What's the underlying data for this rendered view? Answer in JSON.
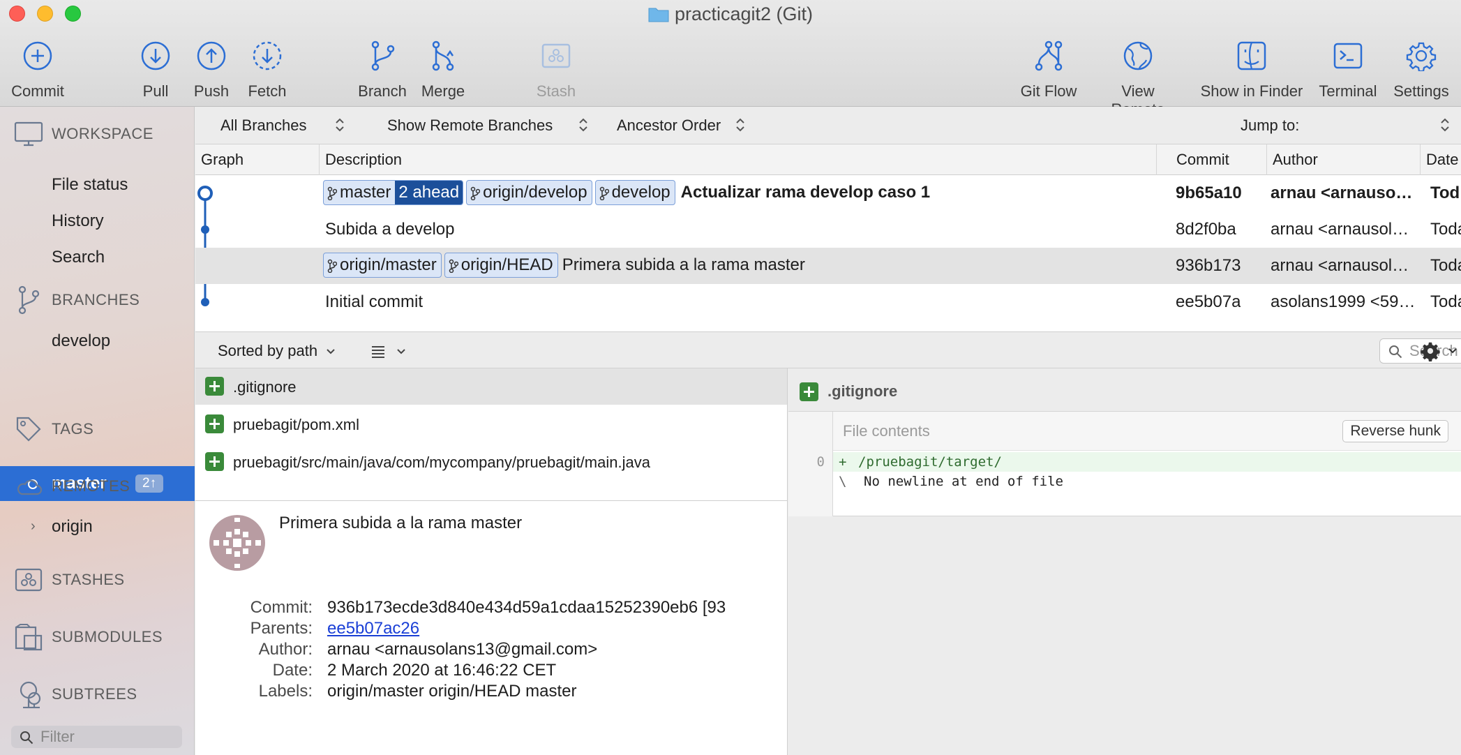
{
  "window": {
    "title": "practicagit2 (Git)"
  },
  "toolbar": {
    "commit": "Commit",
    "pull": "Pull",
    "push": "Push",
    "fetch": "Fetch",
    "branch": "Branch",
    "merge": "Merge",
    "stash": "Stash",
    "git_flow": "Git Flow",
    "view_remote": "View Remote",
    "show_in_finder": "Show in Finder",
    "terminal": "Terminal",
    "settings": "Settings"
  },
  "sidebar": {
    "workspace": "WORKSPACE",
    "workspace_items": [
      "File status",
      "History",
      "Search"
    ],
    "branches": "BRANCHES",
    "branch_items": [
      "develop",
      "master"
    ],
    "master_badge": "2↑",
    "tags": "TAGS",
    "remotes": "REMOTES",
    "remote_items": [
      "origin"
    ],
    "stashes": "STASHES",
    "submodules": "SUBMODULES",
    "subtrees": "SUBTREES",
    "filter_placeholder": "Filter"
  },
  "filters": {
    "branches": "All Branches",
    "remote": "Show Remote Branches",
    "order": "Ancestor Order",
    "jump": "Jump to:"
  },
  "columns": {
    "graph": "Graph",
    "description": "Description",
    "commit": "Commit",
    "author": "Author",
    "date": "Date"
  },
  "commits": [
    {
      "description": "Actualizar rama develop caso 1",
      "hash": "9b65a10",
      "author": "arnau <arnauso…",
      "date": "Tod",
      "bold": true,
      "labels": [
        {
          "name": "master",
          "ahead": "2 ahead"
        },
        {
          "name": "origin/develop"
        },
        {
          "name": "develop"
        }
      ]
    },
    {
      "description": "Subida a develop",
      "hash": "8d2f0ba",
      "author": "arnau <arnausol…",
      "date": "Toda",
      "labels": []
    },
    {
      "description": "Primera subida a la rama master",
      "hash": "936b173",
      "author": "arnau <arnausol…",
      "date": "Toda",
      "selected": true,
      "labels": [
        {
          "name": "origin/master"
        },
        {
          "name": "origin/HEAD"
        }
      ]
    },
    {
      "description": "Initial commit",
      "hash": "ee5b07a",
      "author": "asolans1999 <59…",
      "date": "Toda",
      "labels": []
    }
  ],
  "files_toolbar": {
    "sort": "Sorted by path",
    "search_placeholder": "Search"
  },
  "files": [
    ".gitignore",
    "pruebagit/pom.xml",
    "pruebagit/src/main/java/com/mycompany/pruebagit/main.java"
  ],
  "detail": {
    "message": "Primera subida a la rama master",
    "commit_label": "Commit:",
    "commit": "936b173ecde3d840e434d59a1cdaa15252390eb6 [93",
    "parents_label": "Parents:",
    "parents": "ee5b07ac26",
    "author_label": "Author:",
    "author": "arnau <arnausolans13@gmail.com>",
    "date_label": "Date:",
    "date": "2 March 2020 at 16:46:22 CET",
    "labels_label": "Labels:",
    "labels": "origin/master origin/HEAD master"
  },
  "diff": {
    "file": ".gitignore",
    "hunk_title": "File contents",
    "reverse_hunk": "Reverse hunk",
    "lines": [
      {
        "num": "0",
        "prefix": "+",
        "text": "/pruebagit/target/",
        "type": "add"
      },
      {
        "num": "",
        "prefix": "\\",
        "text": "No newline at end of file",
        "type": "meta"
      }
    ]
  },
  "colors": {
    "accent": "#2c6ed4",
    "graph": "#1f5fb8",
    "added": "#3a8a3a",
    "tag_bg": "#dbe6f7",
    "ahead_bg": "#1c4f9a"
  }
}
